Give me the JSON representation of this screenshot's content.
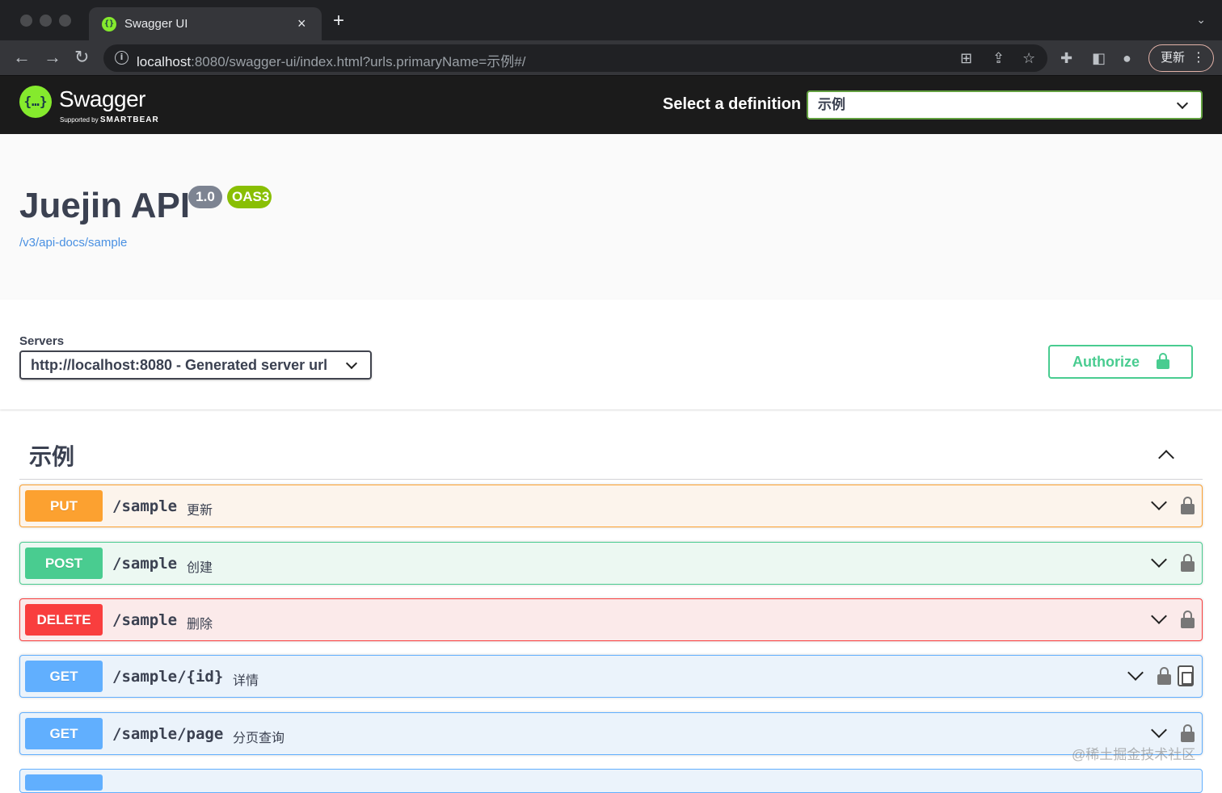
{
  "browser": {
    "tab_title": "Swagger UI",
    "tab_close": "×",
    "new_tab": "+",
    "url_host": "localhost",
    "url_rest": ":8080/swagger-ui/index.html?urls.primaryName=示例#/",
    "update_label": "更新"
  },
  "topbar": {
    "logo_text": "Swagger",
    "logo_sub_prefix": "Supported by",
    "logo_sub_brand": "SMARTBEAR",
    "definition_label": "Select a definition",
    "definition_value": "示例"
  },
  "info": {
    "title": "Juejin API",
    "version": "1.0",
    "oas": "OAS3",
    "link": "/v3/api-docs/sample"
  },
  "servers": {
    "label": "Servers",
    "selected": "http://localhost:8080 - Generated server url"
  },
  "authorize_label": "Authorize",
  "tag": {
    "name": "示例"
  },
  "operations": [
    {
      "method": "PUT",
      "path": "/sample",
      "summary": "更新"
    },
    {
      "method": "POST",
      "path": "/sample",
      "summary": "创建"
    },
    {
      "method": "DELETE",
      "path": "/sample",
      "summary": "删除"
    },
    {
      "method": "GET",
      "path": "/sample/{id}",
      "summary": "详情"
    },
    {
      "method": "GET",
      "path": "/sample/page",
      "summary": "分页查询"
    }
  ],
  "watermark": "@稀土掘金技术社区",
  "colors": {
    "put": "#fca130",
    "post": "#49cc90",
    "delete": "#f93e3e",
    "get": "#61affe",
    "accent": "#85ea2d"
  }
}
